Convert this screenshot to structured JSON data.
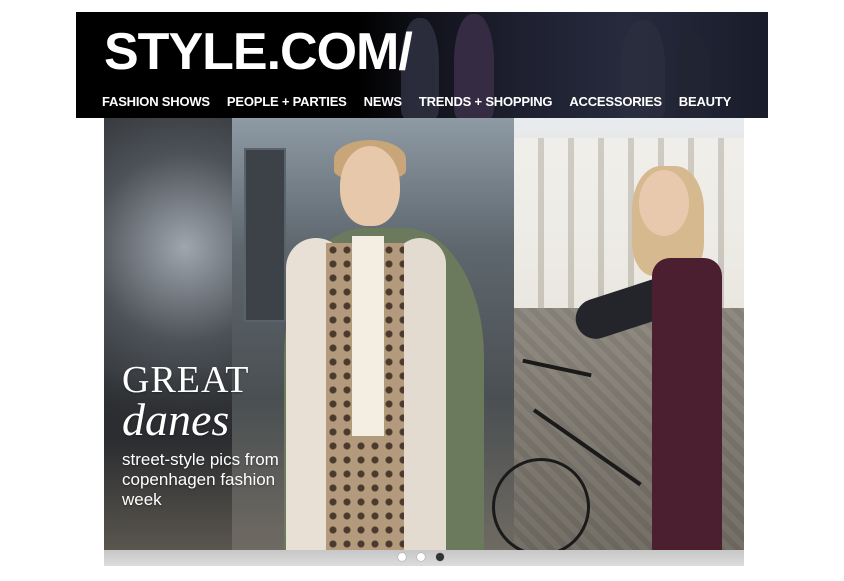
{
  "header": {
    "logo": "STYLE.COM/",
    "nav": [
      {
        "label": "FASHION SHOWS"
      },
      {
        "label": "PEOPLE + PARTIES"
      },
      {
        "label": "NEWS"
      },
      {
        "label": "TRENDS + SHOPPING"
      },
      {
        "label": "ACCESSORIES"
      },
      {
        "label": "BEAUTY"
      }
    ]
  },
  "hero": {
    "headline_line1": "GREAT",
    "headline_line2": "danes",
    "caption": "street-style pics from copenhagen fashion week"
  },
  "slider": {
    "dots": [
      {
        "name": "slide-1",
        "state": "inactive"
      },
      {
        "name": "slide-2",
        "state": "inactive"
      },
      {
        "name": "slide-3",
        "state": "active"
      }
    ]
  },
  "colors": {
    "header_bg": "#000000",
    "text": "#ffffff",
    "dot_active": "#333333",
    "dot_inactive": "#ffffff"
  }
}
